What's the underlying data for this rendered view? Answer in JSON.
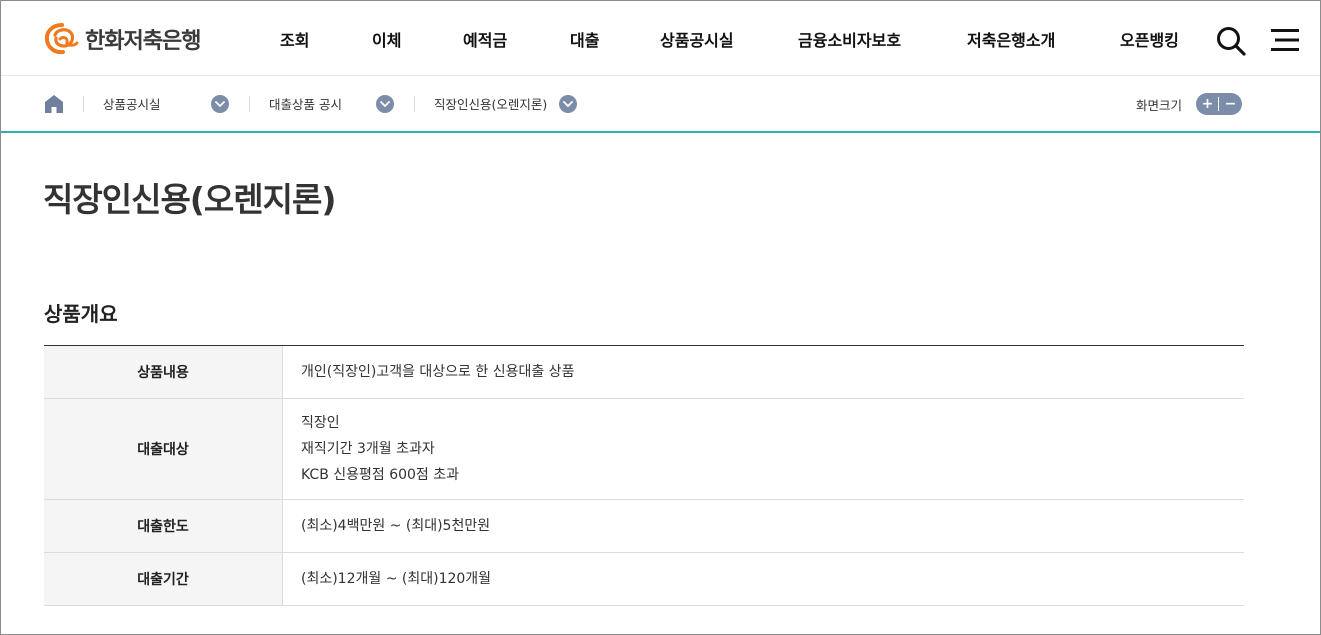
{
  "brand": {
    "name": "한화저축은행",
    "mark_color": "#f07a1e"
  },
  "gnb": {
    "items": [
      "조회",
      "이체",
      "예적금",
      "대출",
      "상품공시실",
      "금융소비자보호",
      "저축은행소개",
      "오픈뱅킹"
    ]
  },
  "header_icons": {
    "search": "search-icon",
    "menu": "hamburger-menu-icon"
  },
  "breadcrumb": {
    "home": "home-icon",
    "items": [
      "상품공시실",
      "대출상품 공시",
      "직장인신용(오렌지론)"
    ]
  },
  "zoom": {
    "label": "화면크기",
    "plus": "+",
    "minus": "−"
  },
  "page": {
    "title": "직장인신용(오렌지론)"
  },
  "overview": {
    "title": "상품개요",
    "rows": [
      {
        "label": "상품내용",
        "lines": [
          "개인(직장인)고객을 대상으로 한 신용대출 상품"
        ]
      },
      {
        "label": "대출대상",
        "lines": [
          "직장인",
          "재직기간 3개월 초과자",
          "KCB 신용평점 600점 초과"
        ]
      },
      {
        "label": "대출한도",
        "lines": [
          "(최소)4백만원 ~ (최대)5천만원"
        ]
      },
      {
        "label": "대출기간",
        "lines": [
          "(최소)12개월 ~ (최대)120개월"
        ]
      }
    ]
  },
  "colors": {
    "accent_line": "#33b1ad",
    "chevron_bg": "#7b8da8",
    "logo_orange": "#f07a1e"
  }
}
